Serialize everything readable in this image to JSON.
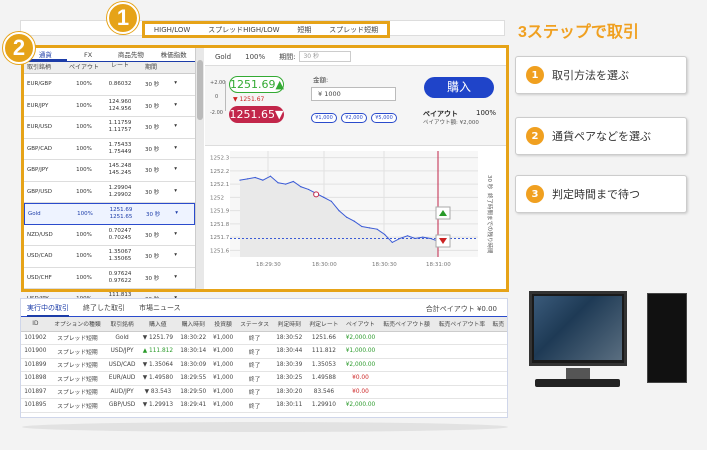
{
  "mode_tabs": [
    "HIGH/LOW",
    "スプレッドHIGH/LOW",
    "短期",
    "スプレッド短期"
  ],
  "badges": {
    "one": "1",
    "two": "2"
  },
  "steps": {
    "title": "3ステップで取引",
    "items": [
      {
        "num": "1",
        "label": "取引方法を選ぶ"
      },
      {
        "num": "2",
        "label": "通貨ペアなどを選ぶ"
      },
      {
        "num": "3",
        "label": "判定時間まで待つ"
      }
    ]
  },
  "asset_tabs": [
    "通貨",
    "FX",
    "商品先物",
    "株価指数"
  ],
  "list_headers": [
    "取引銘柄",
    "ペイアウト",
    "レート",
    "期間"
  ],
  "assets": [
    {
      "name": "EUR/GBP",
      "payout": "100%",
      "rate": [
        "0.86032",
        ""
      ],
      "period": "30 秒"
    },
    {
      "name": "EUR/JPY",
      "payout": "100%",
      "rate": [
        "124.960",
        "124.956"
      ],
      "period": "30 秒"
    },
    {
      "name": "EUR/USD",
      "payout": "100%",
      "rate": [
        "1.11759",
        "1.11757"
      ],
      "period": "30 秒"
    },
    {
      "name": "GBP/CAD",
      "payout": "100%",
      "rate": [
        "1.75433",
        "1.75449"
      ],
      "period": "30 秒"
    },
    {
      "name": "GBP/JPY",
      "payout": "100%",
      "rate": [
        "145.248",
        "145.245"
      ],
      "period": "30 秒"
    },
    {
      "name": "GBP/USD",
      "payout": "100%",
      "rate": [
        "1.29904",
        "1.29902"
      ],
      "period": "30 秒"
    },
    {
      "name": "Gold",
      "payout": "100%",
      "rate": [
        "1251.69",
        "1251.65"
      ],
      "period": "30 秒"
    },
    {
      "name": "NZD/USD",
      "payout": "100%",
      "rate": [
        "0.70247",
        "0.70245"
      ],
      "period": "30 秒"
    },
    {
      "name": "USD/CAD",
      "payout": "100%",
      "rate": [
        "1.35067",
        "1.35065"
      ],
      "period": "30 秒"
    },
    {
      "name": "USD/CHF",
      "payout": "100%",
      "rate": [
        "0.97624",
        "0.97622"
      ],
      "period": "30 秒"
    },
    {
      "name": "USD/JPY",
      "payout": "100%",
      "rate": [
        "111.813",
        "111.811"
      ],
      "period": "30 秒"
    }
  ],
  "symbol": {
    "name": "Gold",
    "payout": "100%",
    "period_label": "期間:",
    "period_value": "30 秒"
  },
  "trade": {
    "price_high": "1251.69▲",
    "price_mid": "▼ 1251.67",
    "price_low": "1251.65▼",
    "scale_top": "+2.00",
    "scale_mid": "0",
    "scale_bottom": "-2.00",
    "amount_label": "金額:",
    "amount_value": "¥ 1000",
    "chips": [
      "¥1,000",
      "¥2,000",
      "¥5,000"
    ],
    "buy_label": "購入",
    "payout_label": "ペイアウト",
    "payout_value": "100%",
    "payout_amount": "ペイアウト額:    ¥2,000"
  },
  "chart_data": {
    "type": "line",
    "x": [
      "18:29:30",
      "18:30:00",
      "18:30:30",
      "18:31:00"
    ],
    "y_ticks": [
      "1252.3",
      "1252.2",
      "1252.1",
      "1252",
      "1251.9",
      "1251.8",
      "1251.7",
      "1251.6"
    ],
    "ylim": [
      1251.55,
      1252.35
    ],
    "series": [
      {
        "values": [
          1252.13,
          1252.14,
          1252.15,
          1252.13,
          1252.16,
          1252.11,
          1252.1,
          1252.12,
          1252.08,
          1252.06,
          1252.03,
          1252.0,
          1251.97,
          1251.9,
          1251.85,
          1251.82,
          1251.78,
          1251.77,
          1251.76,
          1251.72,
          1251.66,
          1251.69,
          1251.71,
          1251.69,
          1251.7,
          1251.69,
          1251.67
        ]
      }
    ],
    "strike": 1251.69,
    "side_label": "30 秒",
    "side_label2": "終了時間までの残り時間"
  },
  "positions": {
    "tabs": [
      "実行中の取引",
      "終了した取引",
      "市場ニュース"
    ],
    "total": "合計ペイアウト ¥0.00",
    "headers": [
      "ID",
      "オプションの種類",
      "取引銘柄",
      "購入値",
      "購入時刻",
      "投資額",
      "ステータス",
      "判定時刻",
      "判定レート",
      "ペイアウト",
      "転売ペイアウト額",
      "転売ペイアウト率",
      "転売"
    ],
    "rows": [
      [
        "101902",
        "スプレッド短期",
        "Gold",
        "▼ 1251.79",
        "18:30:22",
        "¥1,000",
        "終了",
        "18:30:52",
        "1251.66",
        "¥2,000.00"
      ],
      [
        "101900",
        "スプレッド短期",
        "USD/JPY",
        "▲ 111.812",
        "18:30:14",
        "¥1,000",
        "終了",
        "18:30:44",
        "111.812",
        "¥1,000.00"
      ],
      [
        "101899",
        "スプレッド短期",
        "USD/CAD",
        "▼ 1.35064",
        "18:30:09",
        "¥1,000",
        "終了",
        "18:30:39",
        "1.35053",
        "¥2,000.00"
      ],
      [
        "101898",
        "スプレッド短期",
        "EUR/AUD",
        "▼ 1.49580",
        "18:29:55",
        "¥1,000",
        "終了",
        "18:30:25",
        "1.49588",
        "¥0.00"
      ],
      [
        "101897",
        "スプレッド短期",
        "AUD/JPY",
        "▼ 83.543",
        "18:29:50",
        "¥1,000",
        "終了",
        "18:30:20",
        "83.546",
        "¥0.00"
      ],
      [
        "101895",
        "スプレッド短期",
        "GBP/USD",
        "▼ 1.29913",
        "18:29:41",
        "¥1,000",
        "終了",
        "18:30:11",
        "1.29910",
        "¥2,000.00"
      ]
    ]
  }
}
